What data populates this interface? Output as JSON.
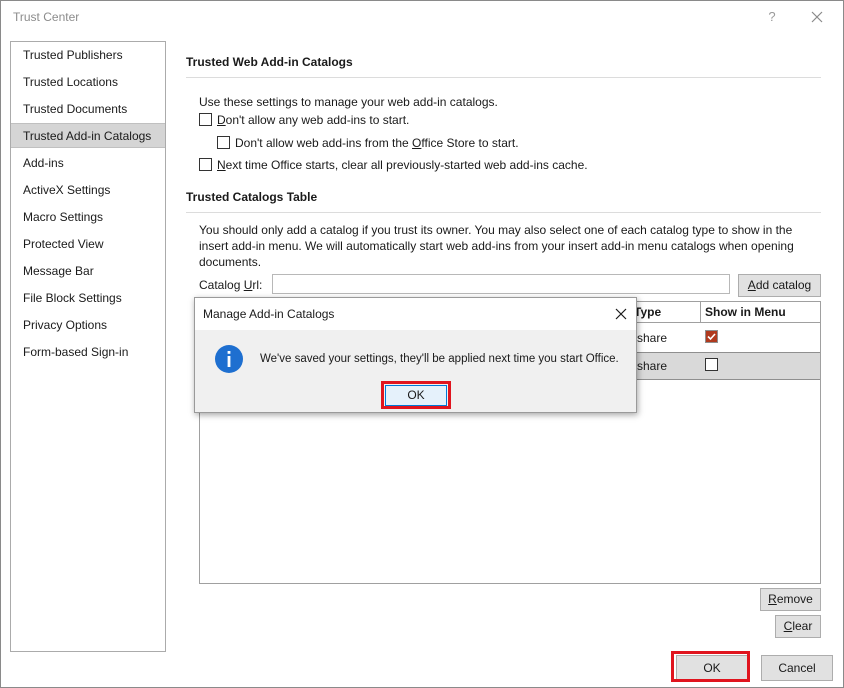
{
  "window": {
    "title": "Trust Center",
    "help_glyph": "?"
  },
  "nav": {
    "items": [
      {
        "label": "Trusted Publishers"
      },
      {
        "label": "Trusted Locations"
      },
      {
        "label": "Trusted Documents"
      },
      {
        "label": "Trusted Add-in Catalogs",
        "selected": true
      },
      {
        "label": "Add-ins"
      },
      {
        "label": "ActiveX Settings"
      },
      {
        "label": "Macro Settings"
      },
      {
        "label": "Protected View"
      },
      {
        "label": "Message Bar"
      },
      {
        "label": "File Block Settings"
      },
      {
        "label": "Privacy Options"
      },
      {
        "label": "Form-based Sign-in"
      }
    ]
  },
  "catalogs_section": {
    "heading": "Trusted Web Add-in Catalogs",
    "intro": "Use these settings to manage your web add-in catalogs.",
    "opt_dont_allow": {
      "pre": "",
      "accel": "D",
      "post": "on't allow any web add-ins to start.",
      "checked": false
    },
    "opt_store": {
      "pre": "Don't allow web add-ins from the ",
      "accel": "O",
      "post": "ffice Store to start.",
      "checked": false
    },
    "opt_clear_cache": {
      "pre": "",
      "accel": "N",
      "post": "ext time Office starts, clear all previously-started web add-ins cache.",
      "checked": false
    }
  },
  "table_section": {
    "heading": "Trusted Catalogs Table",
    "description": "You should only add a catalog if you trust its owner. You may also select one of each catalog type to show in the insert add-in menu. We will automatically start web add-ins from your insert add-in menu catalogs when opening documents.",
    "catalog_url_label": {
      "pre": "Catalog ",
      "accel": "U",
      "post": "rl:"
    },
    "catalog_url_value": "",
    "add_catalog_button": {
      "pre": "",
      "accel": "A",
      "post": "dd catalog"
    },
    "columns": {
      "type": "Type",
      "show_in_menu": "Show in Menu"
    },
    "rows": [
      {
        "type": "share",
        "show_in_menu": true
      },
      {
        "type": "share",
        "show_in_menu": false
      }
    ],
    "remove_button": {
      "pre": "",
      "accel": "R",
      "post": "emove"
    },
    "clear_button": {
      "pre": "",
      "accel": "C",
      "post": "lear"
    }
  },
  "footer": {
    "ok_label": "OK",
    "cancel_label": "Cancel"
  },
  "dialog": {
    "title": "Manage Add-in Catalogs",
    "message": "We've saved your settings, they'll be applied next time you start Office.",
    "ok_label": "OK"
  },
  "colors": {
    "highlight_red": "#e0141e",
    "info_blue": "#1e6fd0",
    "checkbox_check": "#b03a1e"
  }
}
